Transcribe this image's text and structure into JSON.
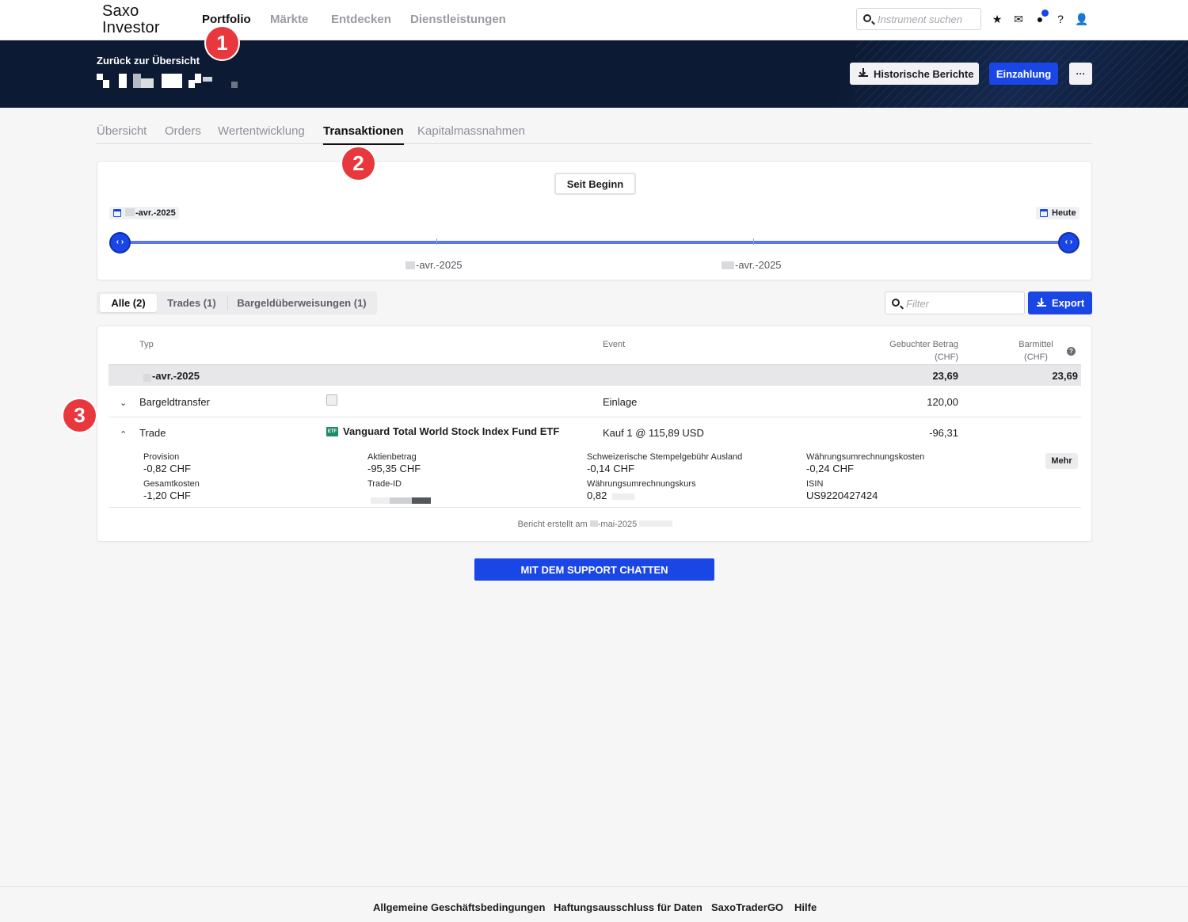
{
  "app": {
    "logo": "Saxo\nInvestor"
  },
  "nav": {
    "items": [
      "Portfolio",
      "Märkte",
      "Entdecken",
      "Dienstleistungen"
    ],
    "active": "Portfolio",
    "search_placeholder": "Instrument suchen"
  },
  "header": {
    "back_link": "Zurück zur Übersicht",
    "buttons": {
      "historical": "Historische Berichte",
      "deposit": "Einzahlung",
      "more": "···"
    }
  },
  "tabs": [
    "Übersicht",
    "Orders",
    "Wertentwicklung",
    "Transaktionen",
    "Kapitalmassnahmen"
  ],
  "active_tab": "Transaktionen",
  "range": {
    "preset": "Seit Beginn",
    "start_chip": "-avr.-2025",
    "end_chip": "Heute",
    "axis_labels": [
      "-avr.-2025",
      "-avr.-2025"
    ]
  },
  "filters": {
    "segments": [
      "Alle (2)",
      "Trades (1)",
      "Bargeldüberweisungen (1)"
    ],
    "active_segment": "Alle (2)",
    "filter_placeholder": "Filter",
    "export_label": "Export"
  },
  "table": {
    "headers": {
      "type": "Typ",
      "event": "Event",
      "booked": "Gebuchter Betrag",
      "booked_unit": "(CHF)",
      "cash": "Barmittel",
      "cash_unit": "(CHF)"
    },
    "group": {
      "date": "-avr.-2025",
      "booked": "23,69",
      "cash": "23,69"
    },
    "rows": [
      {
        "type": "Bargeldtransfer",
        "instrument": "",
        "event": "Einlage",
        "booked": "120,00"
      },
      {
        "type": "Trade",
        "instrument": "Vanguard Total World Stock Index Fund ETF",
        "event": "Kauf 1 @ 115,89 USD",
        "booked": "-96,31"
      }
    ],
    "details": [
      {
        "label": "Provision",
        "value": "-0,82 CHF"
      },
      {
        "label": "Aktienbetrag",
        "value": "-95,35 CHF"
      },
      {
        "label": "Schweizerische Stempelgebühr Ausland",
        "value": "-0,14 CHF"
      },
      {
        "label": "Währungsumrechnungskosten",
        "value": "-0,24 CHF"
      },
      {
        "label": "Gesamtkosten",
        "value": "-1,20 CHF"
      },
      {
        "label": "Trade-ID",
        "value": ""
      },
      {
        "label": "Währungsumrechnungskurs",
        "value": "0,82"
      },
      {
        "label": "ISIN",
        "value": "US9220427424"
      }
    ],
    "more_label": "Mehr",
    "etf_badge": "ETF",
    "footnote_prefix": "Bericht erstellt am",
    "footnote_date": "-mai-2025"
  },
  "support_button": "MIT DEM SUPPORT CHATTEN",
  "footer": [
    "Allgemeine Geschäftsbedingungen",
    "Haftungsausschluss für Daten",
    "SaxoTraderGO",
    "Hilfe"
  ],
  "annotations": [
    "1",
    "2",
    "3"
  ],
  "colors": {
    "accent": "#1a46e6",
    "header_bg": "#0c1a33",
    "annotation": "#e8383d"
  }
}
